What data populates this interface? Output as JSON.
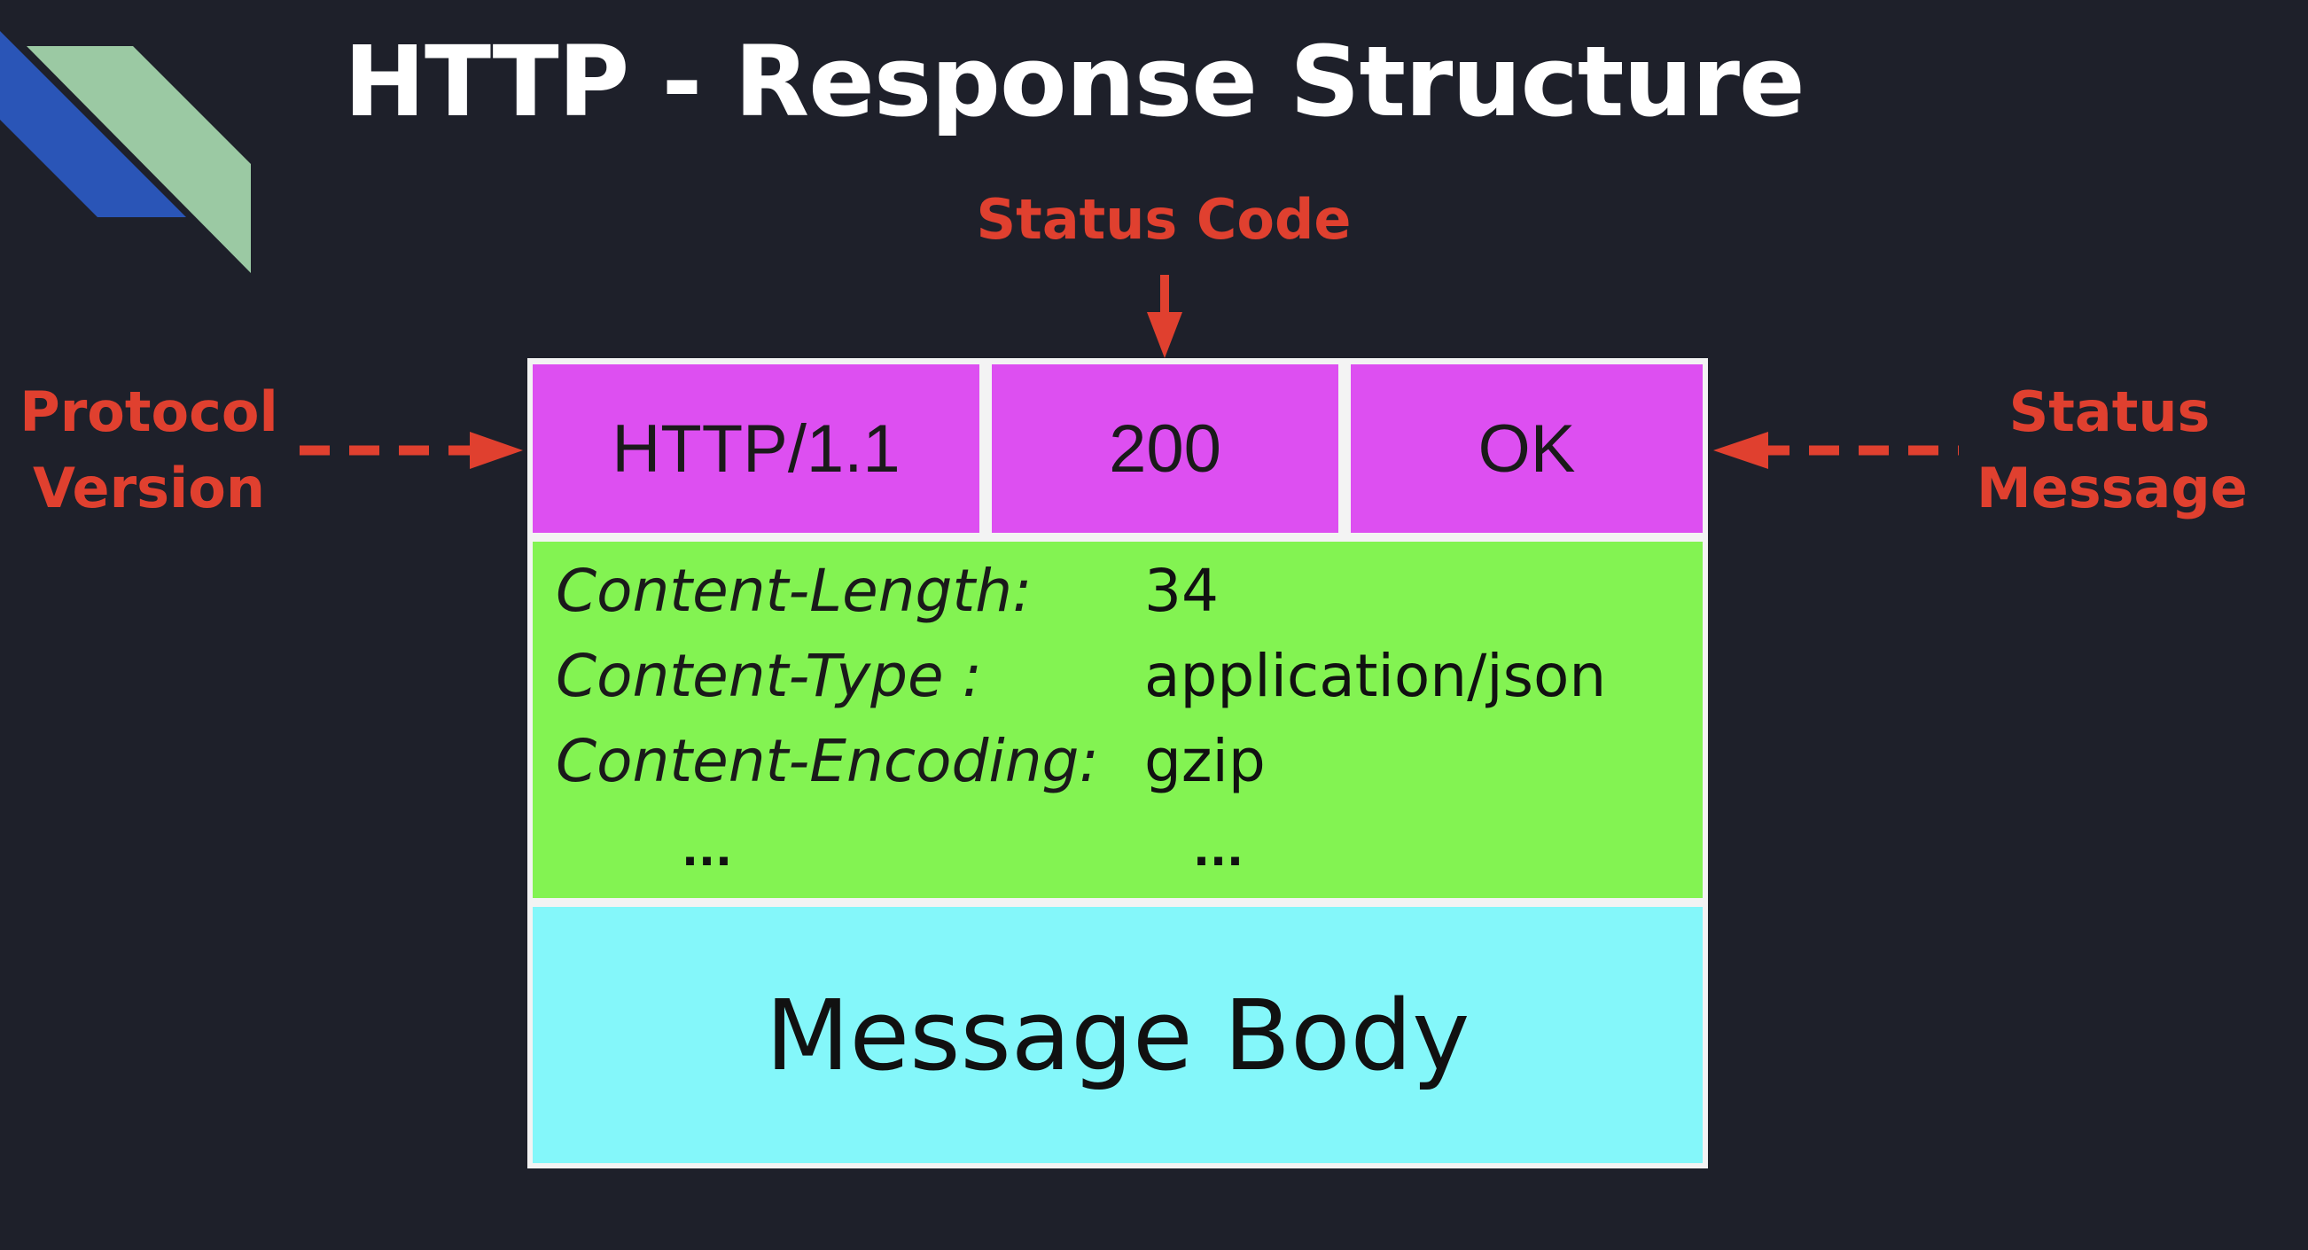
{
  "title": "HTTP - Response Structure",
  "callouts": {
    "protocol_version": [
      "Protocol",
      "Version"
    ],
    "status_code": "Status Code",
    "status_message": [
      "Status",
      "Message"
    ]
  },
  "status_line": {
    "version": "HTTP/1.1",
    "code": "200",
    "message": "OK"
  },
  "headers": [
    {
      "key": "Content-Length:",
      "value": "34"
    },
    {
      "key": "Content-Type :",
      "value": "application/json"
    },
    {
      "key": "Content-Encoding:",
      "value": "gzip"
    }
  ],
  "headers_ellipsis": {
    "key": "...",
    "value": "..."
  },
  "body_label": "Message Body",
  "colors": {
    "background": "#1e202a",
    "callout": "#e0402f",
    "status_line": "#dd4ff1",
    "headers": "#83f352",
    "body": "#84f7fa",
    "logo_blue": "#2a55b7",
    "logo_green": "#9bc9a3"
  }
}
